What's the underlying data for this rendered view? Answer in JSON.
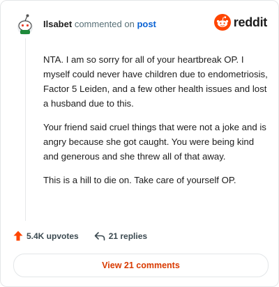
{
  "header": {
    "username": "Ilsabet",
    "action_text": "commented on",
    "post_link": "post"
  },
  "brand": {
    "name": "reddit",
    "icon": "reddit-logo-icon",
    "color": "#ff4500"
  },
  "avatar": {
    "icon": "snoo-avatar-icon"
  },
  "comment": {
    "paragraphs": [
      "NTA. I am so sorry for all of your heartbreak OP. I myself could never have children due to endometriosis, Factor 5 Leiden, and a few other health issues and lost a husband due to this.",
      "Your friend said cruel things that were not a joke and is angry because she got caught. You were being kind and generous and she threw all of that away.",
      "This is a hill to die on. Take care of yourself OP."
    ]
  },
  "actions": {
    "upvotes": "5.4K upvotes",
    "upvote_icon": "upvote-arrow-icon",
    "replies": "21 replies",
    "reply_icon": "reply-arrow-icon"
  },
  "view_comments_label": "View 21 comments",
  "colors": {
    "accent": "#d93a00",
    "link": "#0b63d4",
    "upvote": "#ff4500"
  }
}
